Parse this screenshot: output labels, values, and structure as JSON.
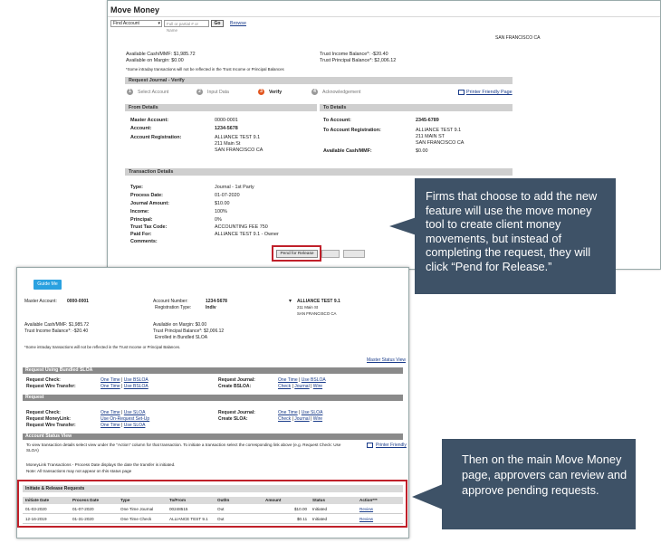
{
  "top": {
    "title": "Move Money",
    "find_select": "Find Account",
    "find_placeholder": "Full or partial # or Name",
    "go_label": "Go",
    "browse_label": "Browse",
    "corner_city": "SAN FRANCISCO CA",
    "available_cash": "Available Cash/MMF: $1,985.72",
    "available_margin": "Available on Margin: $0.00",
    "trust_income": "Trust Income Balance*: -$20.40",
    "trust_principal": "Trust Principal Balance*: $2,006.12",
    "intraday_note": "*Some intraday transactions will not be reflected in the Trust Income or Principal Balances",
    "section_title": "Request Journal - Verify",
    "steps": [
      {
        "num": "1",
        "label": "Select Account"
      },
      {
        "num": "2",
        "label": "Input Data"
      },
      {
        "num": "3",
        "label": "Verify"
      },
      {
        "num": "4",
        "label": "Acknowledgement"
      }
    ],
    "printer_link": "Printer Friendly Page",
    "from_title": "From Details",
    "to_title": "To Details",
    "from": {
      "master_label": "Master Account:",
      "master": "0000-0001",
      "account_label": "Account:",
      "account": "1234-5678",
      "reg_label": "Account Registration:",
      "reg1": "ALLIANCE TEST 9.1",
      "reg2": "211 Main St",
      "reg3": "SAN FRANCISCO CA"
    },
    "to": {
      "account_label": "To Account:",
      "account": "2345-6789",
      "reg_label": "To Account Registration:",
      "reg1": "ALLIANCE TEST 9.1",
      "reg2": "211 MAIN ST",
      "reg3": "SAN FRANCISCO CA",
      "cash_label": "Available Cash/MMF:",
      "cash": "$0.00"
    },
    "txn_title": "Transaction Details",
    "txn": [
      {
        "label": "Type:",
        "value": "Journal - 1st Party"
      },
      {
        "label": "Process Date:",
        "value": "01-07-2020"
      },
      {
        "label": "Journal Amount:",
        "value": "$10.00"
      },
      {
        "label": "Income:",
        "value": "100%"
      },
      {
        "label": "Principal:",
        "value": "0%"
      },
      {
        "label": "Trust Tax Code:",
        "value": "ACCOUNTING FEE 750"
      },
      {
        "label": "Paid For:",
        "value": "ALLIANCE TEST 9.1 - Owner"
      },
      {
        "label": "Comments:",
        "value": ""
      }
    ],
    "pend_label": "Pend for Release"
  },
  "callout1": "Firms that choose to add the new feature will use the move money tool to create client money movements, but instead of completing the request, they will click “Pend for Release.”",
  "callout2": "Then on the main Move Money page, approvers can review and approve pending requests.",
  "bottom": {
    "guide_label": "Guide Me",
    "master_label": "Master Account:",
    "master": "0000-0001",
    "acct_num_label": "Account Number:",
    "acct_num": "1234-5678",
    "reg_type_label": "Registration Type:",
    "reg_type": "Indiv",
    "name1": "ALLIANCE TEST 9.1",
    "name2": "211 Main St",
    "name3": "SAN FRANCISCO CA",
    "available_cash": "Available Cash/MMF: $1,985.72",
    "trust_income": "Trust Income Balance*: -$20.40",
    "available_margin": "Available on Margin: $0.00",
    "trust_principal": "Trust Principal Balance*: $2,006.12",
    "enrolled": "Enrolled in Bundled SLOA",
    "intraday_note": "*Some intraday transactions will not be reflected in the Trust Income or Principal Balances.",
    "master_status": "Master Status View",
    "bundled_title": "Request Using Bundled SLOA",
    "check_label": "Request Check:",
    "wire_label": "Request Wire Transfer:",
    "journal_label": "Request Journal:",
    "create_bsloa_label": "Create BSLOA:",
    "one_time": "One Time",
    "use_bsloa": "Use BSLOA",
    "sep": "|",
    "check": "Check",
    "journal": "Journal",
    "wire": "Wire",
    "request_title": "Request",
    "req_check_label": "Request Check:",
    "req_moneylink_label": "Request MoneyLink:",
    "req_wire_label": "Request Wire Transfer:",
    "req_journal_label": "Request Journal:",
    "create_sloa_label": "Create SLOA:",
    "use_sloa": "Use SLOA",
    "use_onrequest": "Use On-Request Set-Up",
    "status_title": "Account Status View",
    "status_text": "To view transaction details select view under the \"Action\" column for that transaction. To initiate a transaction select the corresponding link above (e.g. Request Check: Use SLOA)",
    "printer_friendly": "Printer Friendly",
    "moneylink_text": "MoneyLink Transactions - Process Date displays the date the transfer is initiated.",
    "note_text": "Note: All transactions may not appear on this status page",
    "ir_title": "Initiate & Release Requests",
    "columns": [
      "Initiate Date",
      "Process Date",
      "Type",
      "To/From",
      "Out/In",
      "Amount",
      "Status",
      "Action***"
    ],
    "rows": [
      [
        "01-03-2020",
        "01-07-2020",
        "One Time Journal",
        "00248515",
        "Out",
        "$10.00",
        "Initiated",
        "Review"
      ],
      [
        "12-16-2019",
        "01-31-2020",
        "One Time Check",
        "ALLIANCE TEST 9.1",
        "Out",
        "$0.11",
        "Initiated",
        "Review"
      ]
    ]
  }
}
